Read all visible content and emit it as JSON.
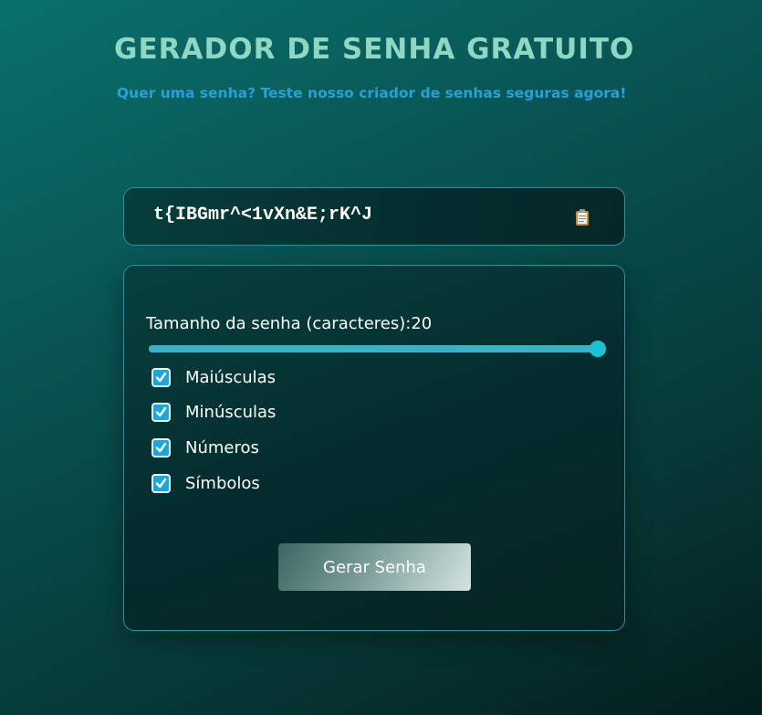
{
  "header": {
    "title": "GERADOR DE SENHA GRATUITO",
    "subtitle": "Quer uma senha? Teste nosso criador de senhas seguras agora!"
  },
  "password": {
    "value": "t{IBGmr^<1vXn&E;rK^J",
    "copy_icon": "clipboard-icon"
  },
  "settings": {
    "length_label": "Tamanho da senha (caracteres):",
    "length_value": "20",
    "slider_level": 1.0,
    "options": [
      {
        "label": "Maiúsculas",
        "checked": true
      },
      {
        "label": "Minúsculas",
        "checked": true
      },
      {
        "label": "Números",
        "checked": true
      },
      {
        "label": "Símbolos",
        "checked": true
      }
    ],
    "generate_label": "Gerar Senha"
  },
  "colors": {
    "title": "#8fd7c2",
    "subtitle": "#29a0d8",
    "border": "#2b8fa8",
    "slider": "#36b3c6",
    "checkbox": "#1aa7e0"
  }
}
